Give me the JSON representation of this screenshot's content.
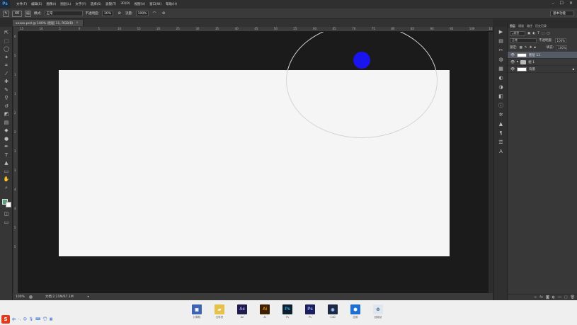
{
  "app": {
    "logo": "Ps",
    "menu": [
      "文件(F)",
      "编辑(E)",
      "图像(I)",
      "图层(L)",
      "文字(Y)",
      "选择(S)",
      "滤镜(T)",
      "3D(D)",
      "视图(V)",
      "窗口(W)",
      "帮助(H)"
    ],
    "window_controls": [
      "–",
      "☐",
      "✕"
    ]
  },
  "options": {
    "brush_size": "40",
    "mode_label": "模式:",
    "mode_value": "正常",
    "opacity_label": "不透明度:",
    "opacity_value": "20%",
    "flow_label": "流量:",
    "flow_value": "100%",
    "workspace": "基本功能"
  },
  "document": {
    "tab_title": "xxxxx.psd @ 100% (图层 11, RGB/8)",
    "tab_close": "×",
    "zoom": "100%",
    "doc_info": "文档:2.21M/67.1M"
  },
  "ruler": {
    "top_ticks": [
      "15",
      "10",
      "5",
      "0",
      "5",
      "10",
      "15",
      "20",
      "25",
      "30",
      "35",
      "40",
      "45",
      "50",
      "55",
      "60",
      "65",
      "70",
      "75",
      "80",
      "85",
      "90",
      "95",
      "100",
      "105"
    ],
    "left_ticks": [
      "0",
      "5",
      "1",
      "1",
      "2",
      "2",
      "3",
      "3",
      "4",
      "4",
      "5",
      "5"
    ]
  },
  "colors": {
    "foreground": "#5aa07e",
    "background": "#ffffff",
    "canvas": "#f5f5f5",
    "dot": "#1a14ee"
  },
  "tools": [
    "move-icon",
    "marquee-icon",
    "lasso-icon",
    "magic-wand-icon",
    "crop-icon",
    "eyedropper-icon",
    "healing-icon",
    "brush-icon",
    "stamp-icon",
    "history-brush-icon",
    "eraser-icon",
    "gradient-icon",
    "blur-icon",
    "dodge-icon",
    "pen-icon",
    "type-icon",
    "path-select-icon",
    "shape-icon",
    "hand-icon",
    "zoom-icon"
  ],
  "layers_panel": {
    "tabs": [
      "图层",
      "通道",
      "路径",
      "历史记录"
    ],
    "filter_label": "类型",
    "blend_mode": "正常",
    "opacity_label": "不透明度:",
    "opacity_value": "100%",
    "lock_label": "锁定:",
    "fill_label": "填充:",
    "fill_value": "100%",
    "layers": [
      {
        "name": "图层 11",
        "type": "pixel",
        "selected": true
      },
      {
        "name": "组 1",
        "type": "group",
        "selected": false
      },
      {
        "name": "背景",
        "type": "pixel",
        "selected": false,
        "locked": true
      }
    ]
  },
  "taskbar": {
    "apps": [
      {
        "name": "computer",
        "label": "计算机",
        "color": "#3f63b5",
        "glyph": "▣"
      },
      {
        "name": "folder",
        "label": "文件夹",
        "color": "#e6c24a",
        "glyph": "▰"
      },
      {
        "name": "after-effects",
        "label": "Ae",
        "color": "#1f1d4c",
        "glyph": "Ae",
        "fg": "#b597ff"
      },
      {
        "name": "illustrator",
        "label": "Ai",
        "color": "#3d1f04",
        "glyph": "Ai",
        "fg": "#ff9a00"
      },
      {
        "name": "photoshop-1",
        "label": "Ps",
        "color": "#0e1f2e",
        "glyph": "Ps",
        "fg": "#31a8ff"
      },
      {
        "name": "photoshop-2",
        "label": "Ps",
        "color": "#1c1f5c",
        "glyph": "Ps",
        "fg": "#9ab3ff"
      },
      {
        "name": "cinema4d",
        "label": "C4D",
        "color": "#1c2a44",
        "glyph": "◉",
        "fg": "#9ac0ff"
      },
      {
        "name": "app-blue",
        "label": "应用",
        "color": "#1d6fd6",
        "glyph": "⬢",
        "fg": "#ffffff"
      },
      {
        "name": "recycle-bin",
        "label": "回收站",
        "color": "#dfe6ee",
        "glyph": "♻",
        "fg": "#4e6f98"
      }
    ]
  }
}
